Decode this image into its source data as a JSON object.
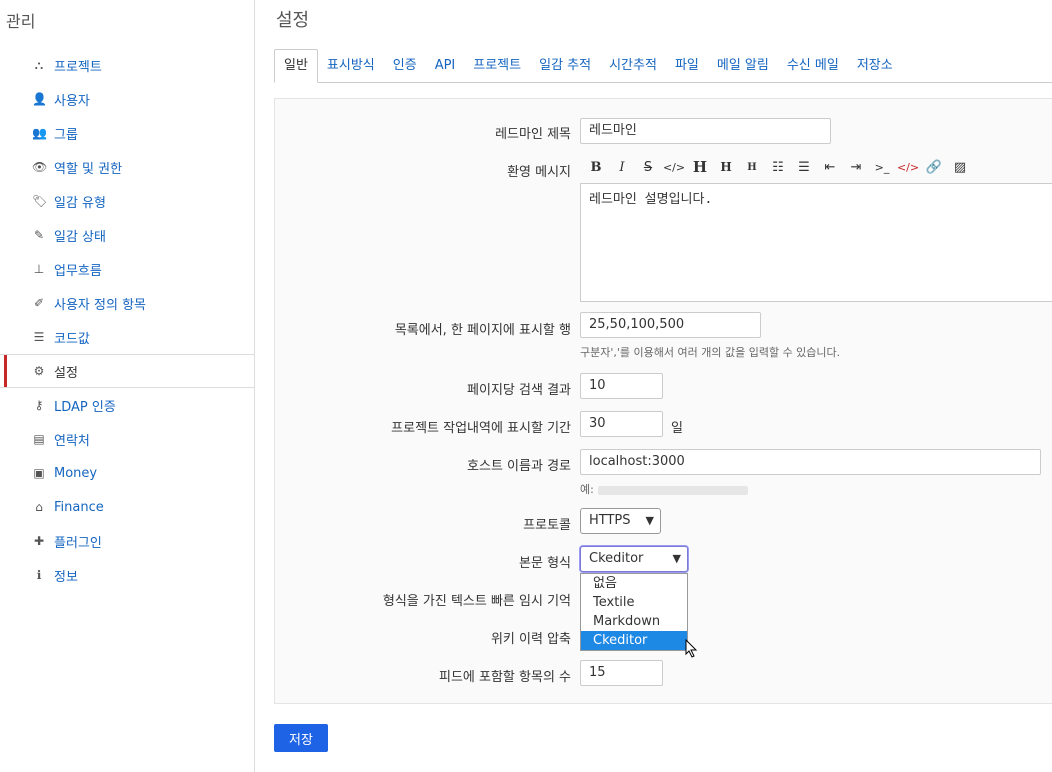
{
  "sidebar": {
    "title": "관리",
    "items": [
      {
        "label": "프로젝트",
        "icon": "projects-icon",
        "glyph": "⛬"
      },
      {
        "label": "사용자",
        "icon": "user-icon",
        "glyph": "👤"
      },
      {
        "label": "그룹",
        "icon": "group-icon",
        "glyph": "👥"
      },
      {
        "label": "역할 및 권한",
        "icon": "eye-icon",
        "glyph": "👁"
      },
      {
        "label": "일감 유형",
        "icon": "tag-icon",
        "glyph": "🏷"
      },
      {
        "label": "일감 상태",
        "icon": "edit-box-icon",
        "glyph": "✎"
      },
      {
        "label": "업무흐름",
        "icon": "workflow-icon",
        "glyph": "⊥"
      },
      {
        "label": "사용자 정의 항목",
        "icon": "custom-field-icon",
        "glyph": "✐"
      },
      {
        "label": "코드값",
        "icon": "list-icon",
        "glyph": "☰"
      },
      {
        "label": "설정",
        "icon": "gear-icon",
        "glyph": "⚙"
      },
      {
        "label": "LDAP 인증",
        "icon": "key-icon",
        "glyph": "⚷"
      },
      {
        "label": "연락처",
        "icon": "contact-card-icon",
        "glyph": "▤"
      },
      {
        "label": "Money",
        "icon": "money-icon",
        "glyph": "▣"
      },
      {
        "label": "Finance",
        "icon": "bank-icon",
        "glyph": "⌂"
      },
      {
        "label": "플러그인",
        "icon": "puzzle-icon",
        "glyph": "✚"
      },
      {
        "label": "정보",
        "icon": "info-icon",
        "glyph": "ℹ"
      }
    ]
  },
  "page": {
    "title": "설정"
  },
  "tabs": [
    "일반",
    "표시방식",
    "인증",
    "API",
    "프로젝트",
    "일감 추적",
    "시간추적",
    "파일",
    "메일 알림",
    "수신 메일",
    "저장소"
  ],
  "form": {
    "app_title_label": "레드마인 제목",
    "app_title_value": "레드마인",
    "welcome_label": "환영 메시지",
    "welcome_value": "레드마인 설명입니다.",
    "per_page_label": "목록에서, 한 페이지에 표시할 행",
    "per_page_value": "25,50,100,500",
    "per_page_hint": "구분자','를 이용해서 여러 개의 값을 입력할 수 있습니다.",
    "search_results_label": "페이지당 검색 결과",
    "search_results_value": "10",
    "activity_days_label": "프로젝트 작업내역에 표시할 기간",
    "activity_days_value": "30",
    "activity_days_unit": "일",
    "host_label": "호스트 이름과 경로",
    "host_value": "localhost:3000",
    "host_hint": "예:",
    "protocol_label": "프로토콜",
    "protocol_value": "HTTPS",
    "text_format_label": "본문 형식",
    "text_format_value": "Ckeditor",
    "text_format_options": [
      "없음",
      "Textile",
      "Markdown",
      "Ckeditor"
    ],
    "cache_label": "형식을 가진 텍스트 빠른 임시 기억",
    "wiki_compress_label": "위키 이력 압축",
    "feed_limit_label": "피드에 포함할 항목의 수",
    "feed_limit_value": "15"
  },
  "save_label": "저장"
}
